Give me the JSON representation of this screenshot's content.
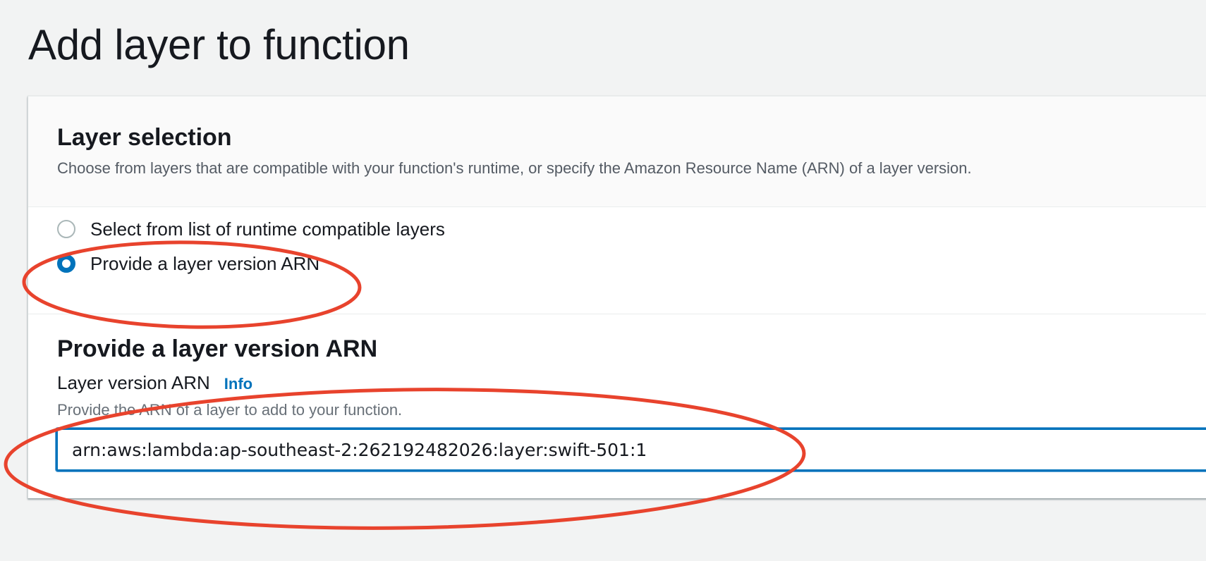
{
  "page": {
    "title": "Add layer to function"
  },
  "layer_selection": {
    "title": "Layer selection",
    "description": "Choose from layers that are compatible with your function's runtime, or specify the Amazon Resource Name (ARN) of a layer version.",
    "options": [
      {
        "label": "Select from list of runtime compatible layers",
        "checked": false
      },
      {
        "label": "Provide a layer version ARN",
        "checked": true
      }
    ]
  },
  "arn_section": {
    "title": "Provide a layer version ARN",
    "field_label": "Layer version ARN",
    "info_link": "Info",
    "hint": "Provide the ARN of a layer to add to your function.",
    "input_value": "arn:aws:lambda:ap-southeast-2:262192482026:layer:swift-501:1"
  },
  "colors": {
    "accent": "#0073bb",
    "annotation": "#e8432d",
    "background": "#f2f3f3"
  }
}
